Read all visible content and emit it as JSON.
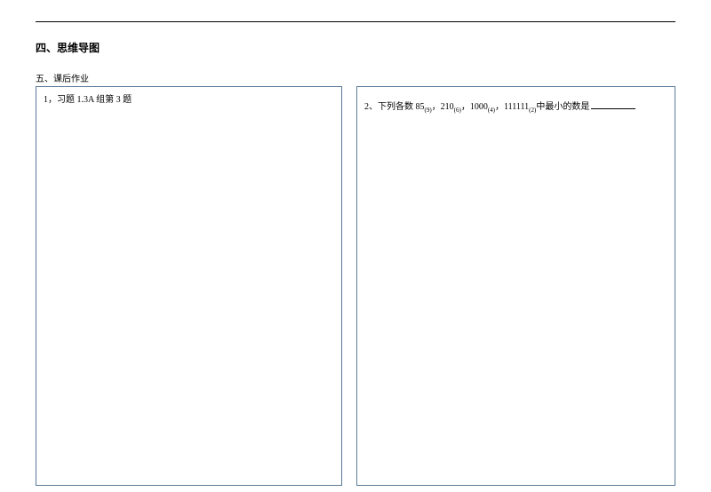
{
  "headings": {
    "section4": "四、思维导图",
    "section5": "五、课后作业"
  },
  "questions": {
    "q1": "1，习题 1.3A 组第 3 题",
    "q2_prefix": "2、下列各数 85",
    "q2_sub1": "(9)",
    "q2_sep1": "，210",
    "q2_sub2": "(6)",
    "q2_sep2": "，1000",
    "q2_sub3": "(4)",
    "q2_sep3": "，111111",
    "q2_sub4": "(2)",
    "q2_suffix": "中最小的数是"
  }
}
